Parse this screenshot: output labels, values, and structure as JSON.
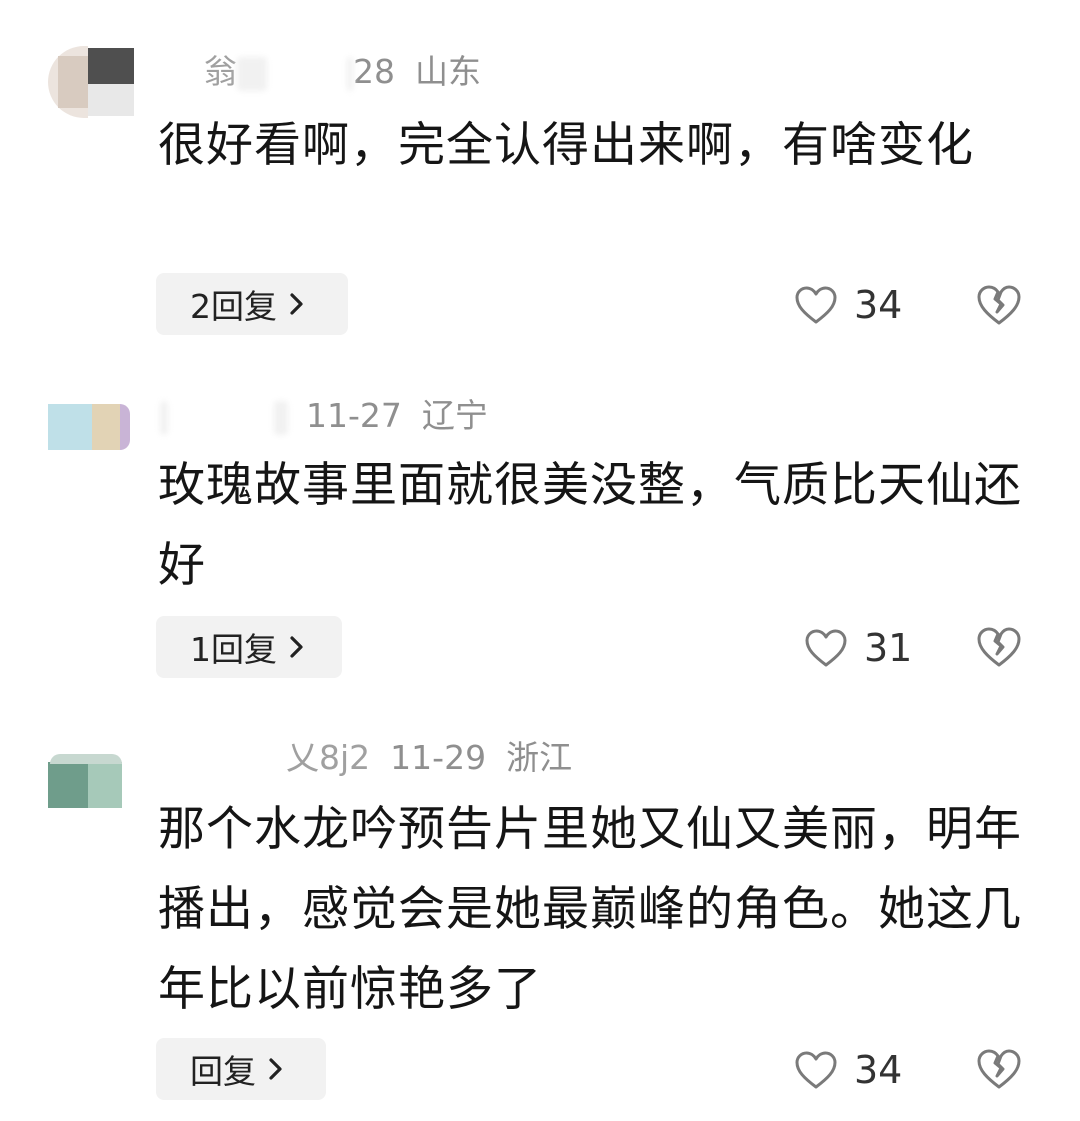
{
  "comments": [
    {
      "username_fragment": "翁",
      "meta_date_fragment": "28",
      "location": "山东",
      "text": "很好看啊，完全认得出来啊，有啥变化",
      "reply_label": "2回复",
      "likes": "34"
    },
    {
      "username_fragment": "",
      "meta_date_fragment": "11-27",
      "location": "辽宁",
      "text": "玫瑰故事里面就很美没整，气质比天仙还好",
      "reply_label": "1回复",
      "likes": "31"
    },
    {
      "username_fragment": "乂8j2",
      "meta_date_fragment": "11-29",
      "location": "浙江",
      "text": "那个水龙吟预告片里她又仙又美丽，明年播出，感觉会是她最巅峰的角色。她这几年比以前惊艳多了",
      "reply_label": "回复",
      "likes": "34"
    }
  ],
  "icons": {
    "like": "heart-outline-icon",
    "dislike": "broken-heart-icon",
    "chevron": "chevron-right-icon"
  },
  "colors": {
    "meta_text": "#8f8f8f",
    "body_text": "#151515",
    "reply_bg": "#f2f2f2",
    "icon_stroke": "#7a7a7a"
  }
}
